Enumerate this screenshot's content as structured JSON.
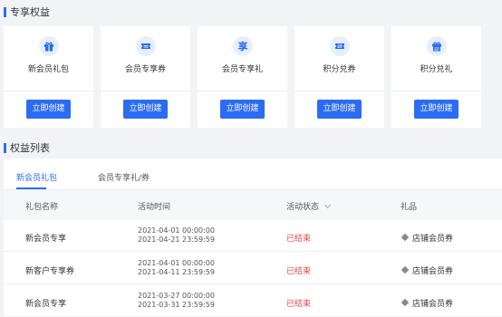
{
  "benefits": {
    "title": "专享权益",
    "cards": [
      {
        "label": "新会员礼包",
        "icon": "gift-box-icon",
        "button": "立即创建"
      },
      {
        "label": "会员专享券",
        "icon": "ticket-icon",
        "button": "立即创建"
      },
      {
        "label": "会员专享礼",
        "icon": "xiang-char-icon",
        "button": "立即创建"
      },
      {
        "label": "积分兑券",
        "icon": "exchange-ticket-icon",
        "button": "立即创建"
      },
      {
        "label": "积分兑礼",
        "icon": "exchange-gift-icon",
        "button": "立即创建"
      }
    ]
  },
  "list": {
    "title": "权益列表",
    "tabs": [
      "新会员礼包",
      "会员专享礼/券"
    ],
    "active_tab": 0,
    "columns": [
      "礼包名称",
      "活动时间",
      "活动状态",
      "礼品"
    ],
    "rows": [
      {
        "name": "新会员专享",
        "start": "2021-04-01 00:00:00",
        "end": "2021-04-21 23:59:59",
        "status": "已结束",
        "gift": "店铺会员券"
      },
      {
        "name": "新客户专享券",
        "start": "2021-04-01 00:00:00",
        "end": "2021-04-11 23:59:59",
        "status": "已结束",
        "gift": "店铺会员券"
      },
      {
        "name": "新会员专享",
        "start": "2021-03-27 00:00:00",
        "end": "2021-03-31 23:59:59",
        "status": "已结束",
        "gift": "店铺会员券"
      }
    ]
  },
  "colors": {
    "accent": "#2b6cf3",
    "status_ended": "#e54545",
    "page_bg": "#f2f3f5"
  }
}
